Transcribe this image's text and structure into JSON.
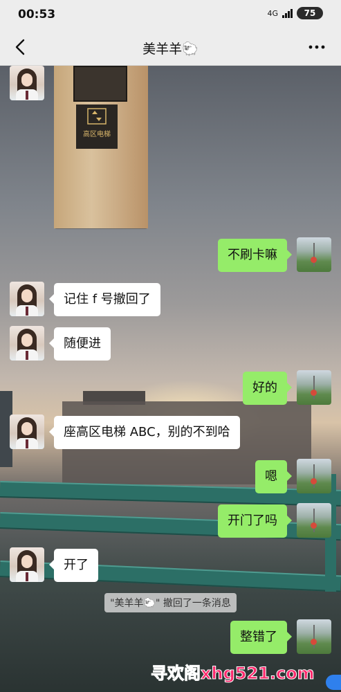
{
  "status_bar": {
    "time": "00:53",
    "network": "4G",
    "battery": "75"
  },
  "header": {
    "title": "美羊羊🐑",
    "back_icon": "chevron-left-icon",
    "more_icon": "ellipsis-icon"
  },
  "messages": [
    {
      "side": "left",
      "type": "image",
      "content": "高区电梯"
    },
    {
      "side": "right",
      "type": "text",
      "text": "不刷卡嘛"
    },
    {
      "side": "left",
      "type": "text",
      "text": "记住 f 号撤回了"
    },
    {
      "side": "left",
      "type": "text",
      "text": "随便进"
    },
    {
      "side": "right",
      "type": "text",
      "text": "好的"
    },
    {
      "side": "left",
      "type": "text",
      "text": "座高区电梯 ABC，别的不到哈"
    },
    {
      "side": "right",
      "type": "text",
      "text": "嗯"
    },
    {
      "side": "right",
      "type": "text",
      "text": "开门了吗"
    },
    {
      "side": "left",
      "type": "text",
      "text": "开了"
    },
    {
      "side": "right",
      "type": "text",
      "text": "整错了"
    }
  ],
  "system_notice": "\"美羊羊🐑\" 撤回了一条消息",
  "watermark": "寻欢阁xhg521.com",
  "colors": {
    "sent_bubble": "#95ec69",
    "received_bubble": "#ffffff",
    "nav_background": "#ededed"
  }
}
